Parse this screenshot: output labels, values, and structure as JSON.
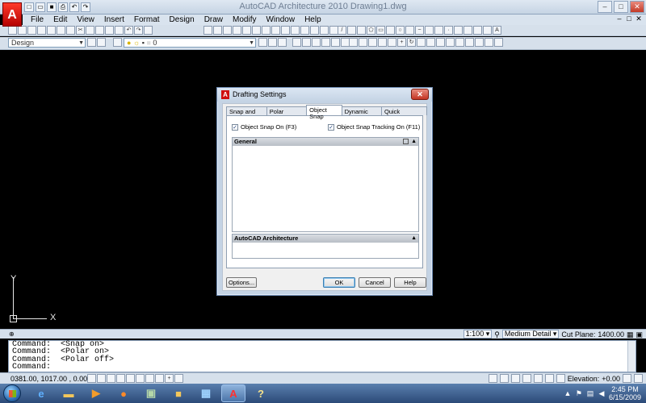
{
  "window": {
    "title": "AutoCAD Architecture 2010   Drawing1.dwg",
    "logo": "A",
    "controls": [
      "–",
      "□",
      "✕"
    ]
  },
  "quick_access": [
    "new",
    "open",
    "save",
    "print",
    "undo",
    "redo"
  ],
  "menu": {
    "items": [
      "File",
      "Edit",
      "View",
      "Insert",
      "Format",
      "Design",
      "Draw",
      "Modify",
      "Window",
      "Help"
    ],
    "doc_controls": [
      "–",
      "□",
      "✕"
    ]
  },
  "toolbars": {
    "workspace_combo": "Design",
    "layer_combo": "0"
  },
  "ucs": {
    "x_label": "X",
    "y_label": "Y"
  },
  "drawing_status": {
    "scale": "1:100",
    "detail": "Medium Detail",
    "cut_plane_label": "Cut Plane:",
    "cut_plane_value": "1400.00"
  },
  "command_window": {
    "lines": [
      "Command:  <Snap on>",
      "Command:  <Polar on>",
      "Command:  <Polar off>",
      "Command:"
    ]
  },
  "status_bar": {
    "coordinates": "0381.00, 1017.00 , 0.00",
    "elevation_label": "Elevation:",
    "elevation_value": "+0.00"
  },
  "taskbar": {
    "apps": [
      "windows-explorer",
      "internet-explorer",
      "media-player",
      "firefox",
      "network",
      "folder",
      "remote-desktop",
      "autocad",
      "help"
    ],
    "time": "2:45 PM",
    "date": "6/15/2009"
  },
  "dialog": {
    "title": "Drafting Settings",
    "close_label": "✕",
    "tabs": [
      "Snap and Grid",
      "Polar Tracking",
      "Object Snap",
      "Dynamic Input",
      "Quick Properties"
    ],
    "active_tab": "Object Snap",
    "object_snap_on": "Object Snap On (F3)",
    "object_snap_tracking_on": "Object Snap Tracking On (F11)",
    "section_general": "General",
    "section_architecture": "AutoCAD Architecture",
    "buttons": {
      "options": "Options...",
      "ok": "OK",
      "cancel": "Cancel",
      "help": "Help"
    }
  }
}
